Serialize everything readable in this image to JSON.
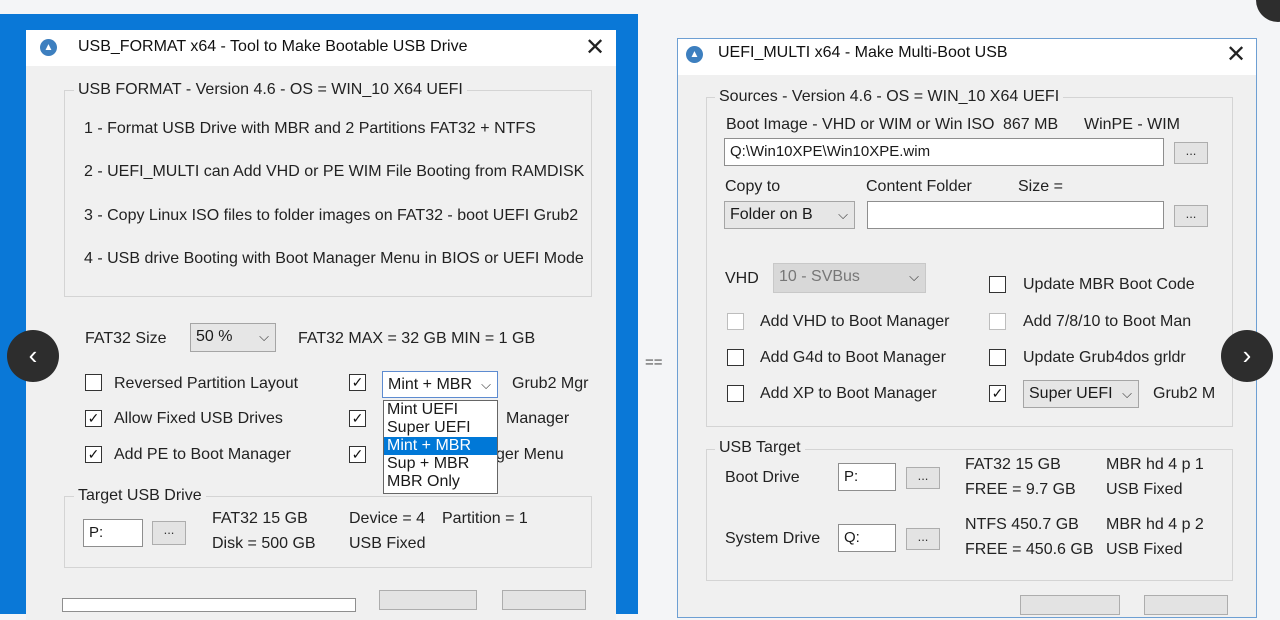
{
  "left_window": {
    "title": "USB_FORMAT x64 - Tool to Make Bootable USB Drive",
    "info_group": {
      "label": "USB FORMAT - Version 4.6  -  OS = WIN_10 X64  UEFI",
      "lines": [
        "1 - Format USB Drive with MBR and 2 Partitions FAT32 + NTFS",
        "2 - UEFI_MULTI can Add VHD or PE WIM File Booting from RAMDISK",
        "3 - Copy Linux ISO files to folder images on FAT32 - boot UEFI Grub2",
        "4 - USB drive Booting with Boot Manager Menu in BIOS or UEFI Mode"
      ]
    },
    "fat32_size_label": "FAT32  Size",
    "fat32_size_value": "50 %",
    "fat32_limits": "FAT32   MAX = 32 GB   MIN = 1 GB",
    "options_left": [
      {
        "label": "Reversed Partition Layout",
        "checked": false
      },
      {
        "label": "Allow Fixed USB Drives",
        "checked": true
      },
      {
        "label": "Add PE to Boot Manager",
        "checked": true
      }
    ],
    "options_right_partial": [
      "Manager",
      "ger Menu"
    ],
    "grub_combo_value": "Mint + MBR",
    "grub_label": "Grub2 Mgr",
    "grub_dropdown": [
      "Mint   UEFI",
      "Super UEFI",
      "Mint + MBR",
      "Sup + MBR",
      "MBR  Only"
    ],
    "grub_selected_index": 2,
    "target_group": {
      "label": "Target USB Drive",
      "drive_value": "P:",
      "browse_label": "...",
      "fs": "FAT32   15 GB",
      "disk": "Disk  =  500 GB",
      "device": "Device = 4",
      "partition": "Partition = 1",
      "bus": "USB   Fixed"
    }
  },
  "separator": "==",
  "right_window": {
    "title": "UEFI_MULTI x64 - Make Multi-Boot USB",
    "sources_group": {
      "label": "Sources   - Version 4.6  -  OS = WIN_10 X64  UEFI",
      "boot_image_label": "Boot Image - VHD or WIM or Win ISO",
      "boot_image_size": "867 MB",
      "boot_image_type": "WinPE - WIM",
      "boot_image_path": "Q:\\Win10XPE\\Win10XPE.wim",
      "browse_label": "...",
      "copy_to_label": "Copy to",
      "copy_to_value": "Folder on B",
      "content_folder_label": "Content Folder",
      "size_label": "Size  ="
    },
    "vhd_label": "VHD",
    "vhd_value": "10 - SVBus",
    "options_left": [
      {
        "label": "Add VHD to Boot Manager",
        "checked": false,
        "disabled": true
      },
      {
        "label": "Add G4d to Boot Manager",
        "checked": false,
        "disabled": false
      },
      {
        "label": "Add XP  to Boot Manager",
        "checked": false,
        "disabled": false
      }
    ],
    "options_right": [
      {
        "label": "Update MBR Boot Code",
        "checked": false,
        "disabled": false
      },
      {
        "label": "Add 7/8/10 to Boot Man",
        "checked": false,
        "disabled": true
      },
      {
        "label": "Update Grub4dos grldr",
        "checked": false,
        "disabled": false
      }
    ],
    "uefi_combo_value": "Super UEFI",
    "uefi_label": "Grub2 M",
    "usb_target_group": {
      "label": "USB Target",
      "boot_drive_label": "Boot  Drive",
      "boot_drive_value": "P:",
      "boot_fs": "FAT32    15 GB",
      "boot_free": "FREE  = 9.7 GB",
      "boot_part": "MBR  hd 4  p 1",
      "boot_bus": "USB   Fixed",
      "system_drive_label": "System Drive",
      "system_drive_value": "Q:",
      "system_fs": "NTFS     450.7 GB",
      "system_free": "FREE  = 450.6 GB",
      "system_part": "MBR  hd 4  p 2",
      "system_bus": "USB   Fixed"
    }
  },
  "nav": {
    "prev_glyph": "‹",
    "next_glyph": "›"
  }
}
